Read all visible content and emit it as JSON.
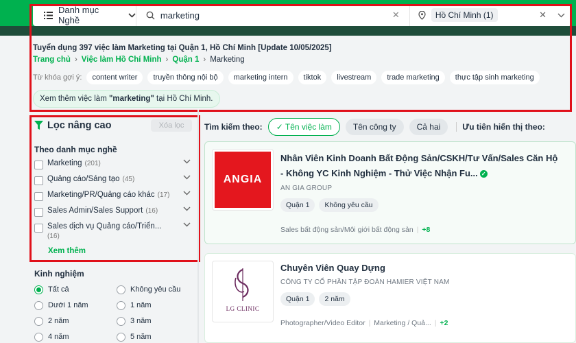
{
  "search": {
    "category_label": "Danh mục Nghề",
    "query": "marketing",
    "location": "Hồ Chí Minh (1)"
  },
  "header": {
    "title": "Tuyển dụng 397 việc làm Marketing tại Quận 1, Hồ Chí Minh [Update 10/05/2025]",
    "breadcrumb": [
      "Trang chủ",
      "Việc làm Hồ Chí Minh",
      "Quận 1",
      "Marketing"
    ],
    "keywords_label": "Từ khóa gợi ý:",
    "keywords": [
      "content writer",
      "truyền thông nội bộ",
      "marketing intern",
      "tiktok",
      "livestream",
      "trade marketing",
      "thực tập sinh marketing"
    ],
    "more_prefix": "Xem thêm việc làm ",
    "more_keyword": "\"marketing\"",
    "more_suffix": " tại Hồ Chí Minh."
  },
  "filter": {
    "title": "Lọc nâng cao",
    "clear_label": "Xóa lọc",
    "category_heading": "Theo danh mục nghề",
    "categories": [
      {
        "label": "Marketing",
        "count": "(201)"
      },
      {
        "label": "Quảng cáo/Sáng tạo",
        "count": "(45)"
      },
      {
        "label": "Marketing/PR/Quảng cáo khác",
        "count": "(17)"
      },
      {
        "label": "Sales Admin/Sales Support",
        "count": "(16)"
      },
      {
        "label": "Sales dịch vụ Quảng cáo/Triển...",
        "count": "(16)"
      }
    ],
    "see_more": "Xem thêm",
    "experience_heading": "Kinh nghiệm",
    "experience": [
      "Tất cả",
      "Không yêu cầu",
      "Dưới 1 năm",
      "1 năm",
      "2 năm",
      "3 năm",
      "4 năm",
      "5 năm"
    ],
    "experience_selected": "Tất cả"
  },
  "toolbar": {
    "search_by_label": "Tìm kiếm theo:",
    "tabs": [
      "Tên việc làm",
      "Tên công ty",
      "Cả hai"
    ],
    "active_tab": "Tên việc làm",
    "priority_label": "Ưu tiên hiển thị theo:"
  },
  "jobs": [
    {
      "title": "Nhân Viên Kinh Doanh Bất Động Sản/CSKH/Tư Vấn/Sales Căn Hộ - Không YC Kinh Nghiệm - Thử Việc Nhận Fu...",
      "company": "AN GIA GROUP",
      "logo_text": "ANGIA",
      "tags": [
        "Quận 1",
        "Không yêu cầu"
      ],
      "category": "Sales bất động sản/Môi giới bất động sản",
      "extra": "+8"
    },
    {
      "title": "Chuyên Viên Quay Dựng",
      "company": "CÔNG TY CỔ PHẦN TẬP ĐOÀN HAMIER VIỆT NAM",
      "logo_text": "LG CLINIC",
      "tags": [
        "Quận 1",
        "2 năm"
      ],
      "category": "Photographer/Video Editor",
      "category2": "Marketing / Quả...",
      "extra": "+2"
    }
  ],
  "colors": {
    "accent": "#00b14f",
    "highlight_box": "#e0101a",
    "logo_red": "#e4171e",
    "logo_purple": "#6b2a5e"
  }
}
